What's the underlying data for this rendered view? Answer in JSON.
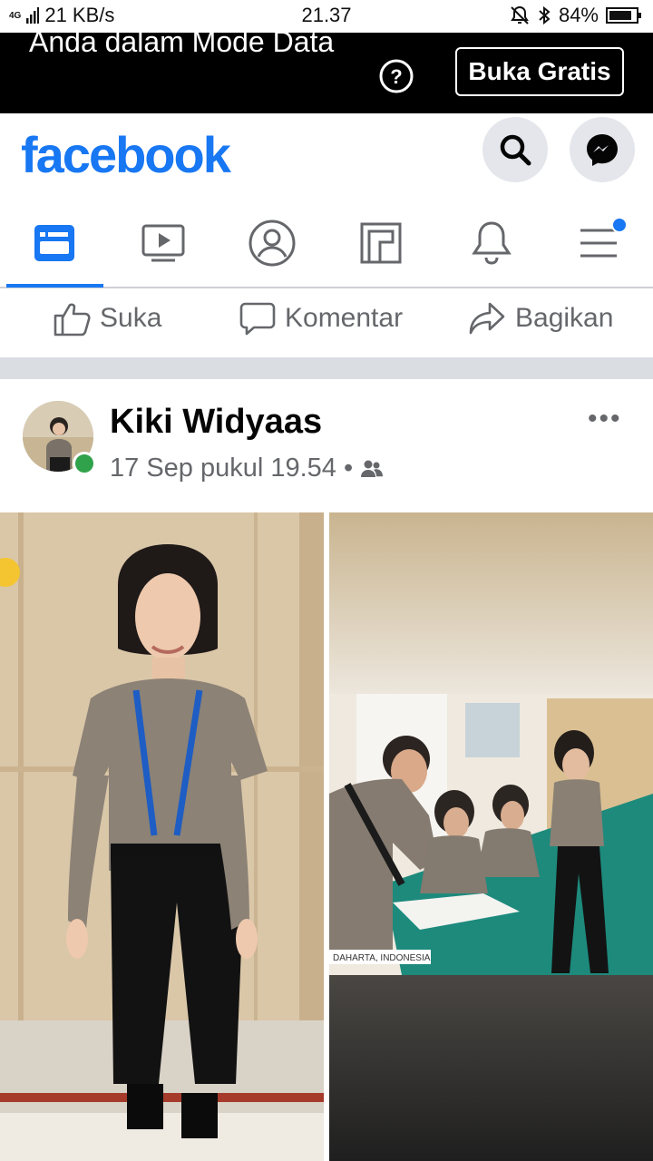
{
  "status_bar": {
    "network": "4G",
    "speed": "21 KB/s",
    "time": "21.37",
    "battery": "84%"
  },
  "banner": {
    "text": "Anda dalam Mode Data",
    "button": "Buka Gratis"
  },
  "header": {
    "logo": "facebook"
  },
  "actions": {
    "like": "Suka",
    "comment": "Komentar",
    "share": "Bagikan"
  },
  "post": {
    "author": "Kiki Widyaas",
    "timestamp": "17 Sep pukul 19.54",
    "separator": "•",
    "more": "•••",
    "photo_caption": "DAHARTA, INDONESIA"
  },
  "colors": {
    "brand": "#1877f2",
    "online": "#31a24c"
  }
}
